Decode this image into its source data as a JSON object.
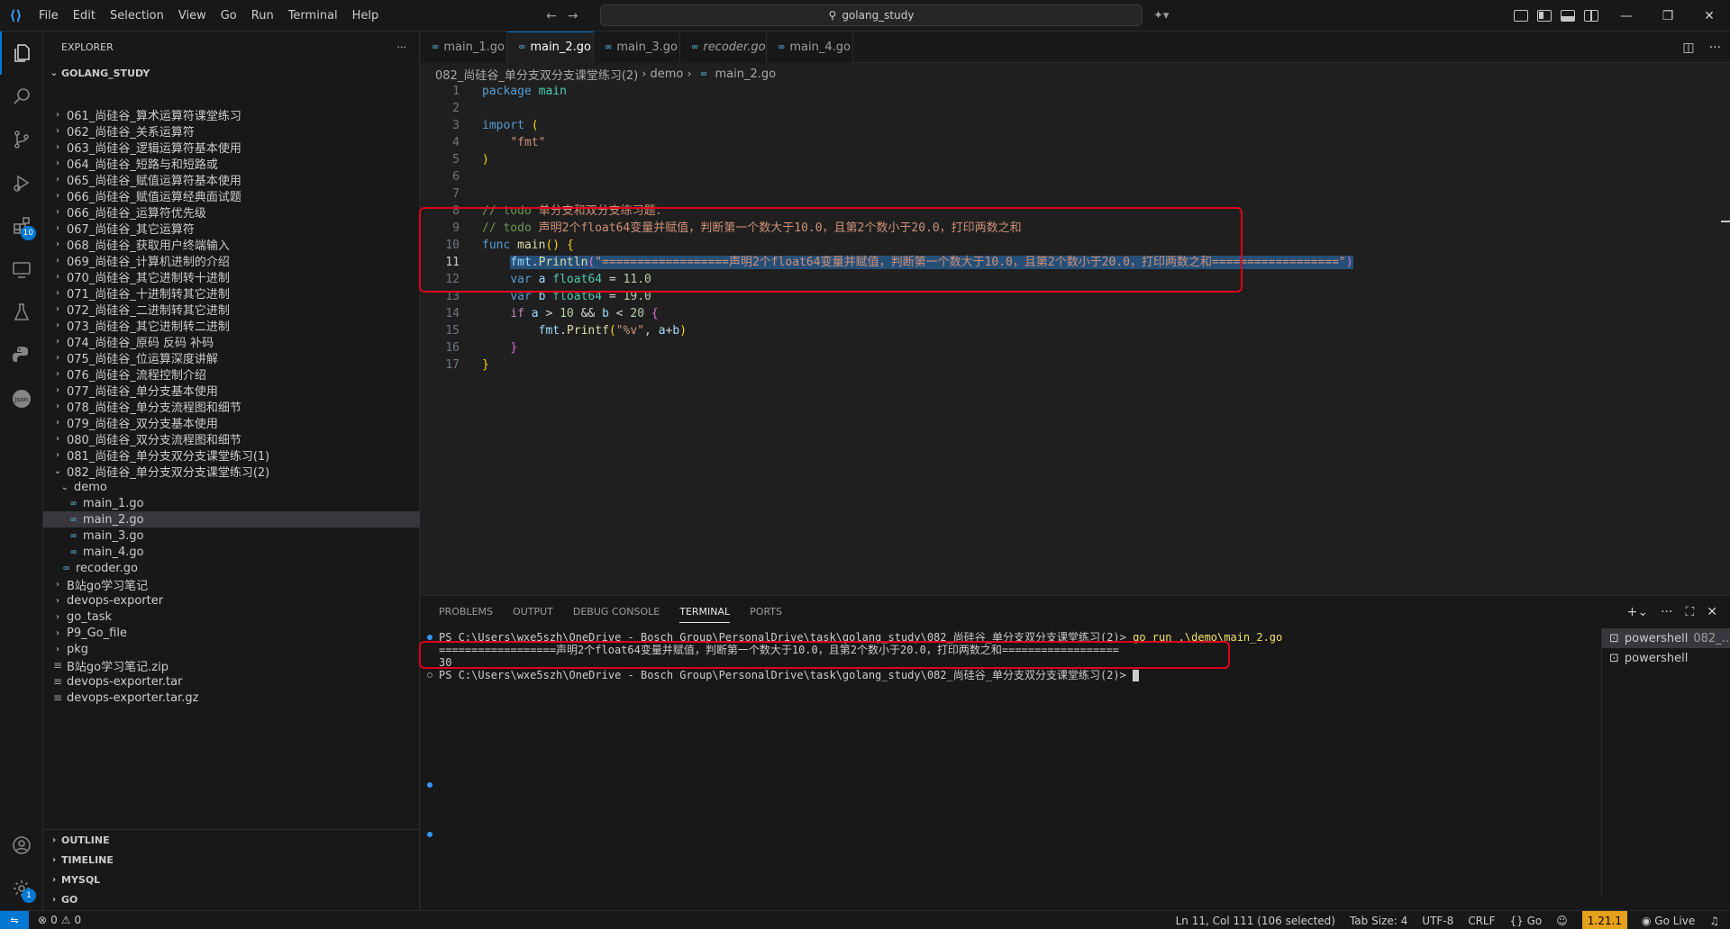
{
  "titlebar": {
    "menu": [
      "File",
      "Edit",
      "Selection",
      "View",
      "Go",
      "Run",
      "Terminal",
      "Help"
    ],
    "search": "golang_study"
  },
  "activity": {
    "extensions_badge": "10",
    "settings_badge": "1"
  },
  "sidebar": {
    "title": "EXPLORER",
    "root": "GOLANG_STUDY",
    "items": [
      {
        "label": "061_尚硅谷_算术运算符课堂练习",
        "kind": "folder",
        "depth": 1
      },
      {
        "label": "062_尚硅谷_关系运算符",
        "kind": "folder",
        "depth": 1
      },
      {
        "label": "063_尚硅谷_逻辑运算符基本使用",
        "kind": "folder",
        "depth": 1
      },
      {
        "label": "064_尚硅谷_短路与和短路或",
        "kind": "folder",
        "depth": 1
      },
      {
        "label": "065_尚硅谷_赋值运算符基本使用",
        "kind": "folder",
        "depth": 1
      },
      {
        "label": "066_尚硅谷_赋值运算经典面试题",
        "kind": "folder",
        "depth": 1
      },
      {
        "label": "066_尚硅谷_运算符优先级",
        "kind": "folder",
        "depth": 1
      },
      {
        "label": "067_尚硅谷_其它运算符",
        "kind": "folder",
        "depth": 1
      },
      {
        "label": "068_尚硅谷_获取用户终端输入",
        "kind": "folder",
        "depth": 1
      },
      {
        "label": "069_尚硅谷_计算机进制的介绍",
        "kind": "folder",
        "depth": 1
      },
      {
        "label": "070_尚硅谷_其它进制转十进制",
        "kind": "folder",
        "depth": 1
      },
      {
        "label": "071_尚硅谷_十进制转其它进制",
        "kind": "folder",
        "depth": 1
      },
      {
        "label": "072_尚硅谷_二进制转其它进制",
        "kind": "folder",
        "depth": 1
      },
      {
        "label": "073_尚硅谷_其它进制转二进制",
        "kind": "folder",
        "depth": 1
      },
      {
        "label": "074_尚硅谷_原码 反码 补码",
        "kind": "folder",
        "depth": 1
      },
      {
        "label": "075_尚硅谷_位运算深度讲解",
        "kind": "folder",
        "depth": 1
      },
      {
        "label": "076_尚硅谷_流程控制介绍",
        "kind": "folder",
        "depth": 1
      },
      {
        "label": "077_尚硅谷_单分支基本使用",
        "kind": "folder",
        "depth": 1
      },
      {
        "label": "078_尚硅谷_单分支流程图和细节",
        "kind": "folder",
        "depth": 1
      },
      {
        "label": "079_尚硅谷_双分支基本使用",
        "kind": "folder",
        "depth": 1
      },
      {
        "label": "080_尚硅谷_双分支流程图和细节",
        "kind": "folder",
        "depth": 1
      },
      {
        "label": "081_尚硅谷_单分支双分支课堂练习(1)",
        "kind": "folder",
        "depth": 1
      },
      {
        "label": "082_尚硅谷_单分支双分支课堂练习(2)",
        "kind": "folder-open",
        "depth": 1
      },
      {
        "label": "demo",
        "kind": "folder-open",
        "depth": 2
      },
      {
        "label": "main_1.go",
        "kind": "go",
        "depth": 3
      },
      {
        "label": "main_2.go",
        "kind": "go",
        "depth": 3,
        "selected": true
      },
      {
        "label": "main_3.go",
        "kind": "go",
        "depth": 3
      },
      {
        "label": "main_4.go",
        "kind": "go",
        "depth": 3
      },
      {
        "label": "recoder.go",
        "kind": "go",
        "depth": 2
      },
      {
        "label": "B站go学习笔记",
        "kind": "folder",
        "depth": 1
      },
      {
        "label": "devops-exporter",
        "kind": "folder",
        "depth": 1
      },
      {
        "label": "go_task",
        "kind": "folder",
        "depth": 1
      },
      {
        "label": "P9_Go_file",
        "kind": "folder",
        "depth": 1
      },
      {
        "label": "pkg",
        "kind": "folder",
        "depth": 1
      },
      {
        "label": "B站go学习笔记.zip",
        "kind": "file",
        "depth": 1
      },
      {
        "label": "devops-exporter.tar",
        "kind": "file",
        "depth": 1
      },
      {
        "label": "devops-exporter.tar.gz",
        "kind": "file",
        "depth": 1
      }
    ],
    "sections": [
      "OUTLINE",
      "TIMELINE",
      "MYSQL",
      "GO"
    ]
  },
  "editor": {
    "tabs": [
      {
        "label": "main_1.go",
        "active": false,
        "italic": false
      },
      {
        "label": "main_2.go",
        "active": true,
        "italic": false
      },
      {
        "label": "main_3.go",
        "active": false,
        "italic": false
      },
      {
        "label": "recoder.go",
        "active": false,
        "italic": true
      },
      {
        "label": "main_4.go",
        "active": false,
        "italic": false
      }
    ],
    "breadcrumb": [
      "082_尚硅谷_单分支双分支课堂练习(2)",
      "demo",
      "main_2.go"
    ],
    "current_line": 11,
    "lines": [
      [
        [
          "kw",
          "package"
        ],
        [
          "pn",
          " "
        ],
        [
          "ty",
          "main"
        ]
      ],
      [],
      [
        [
          "kw",
          "import"
        ],
        [
          "pn",
          " "
        ],
        [
          "br1",
          "("
        ]
      ],
      [
        [
          "pn",
          "    "
        ],
        [
          "str",
          "\"fmt\""
        ]
      ],
      [
        [
          "br1",
          ")"
        ]
      ],
      [],
      [],
      [
        [
          "cm",
          "// todo "
        ],
        [
          "cmh",
          "单分支和双分支练习题："
        ]
      ],
      [
        [
          "cm",
          "// todo "
        ],
        [
          "cmh",
          "声明2个float64变量并赋值，判断第一个数大于10.0，且第2个数小于20.0，打印两数之和"
        ]
      ],
      [
        [
          "kw",
          "func"
        ],
        [
          "pn",
          " "
        ],
        [
          "fn",
          "main"
        ],
        [
          "br1",
          "()"
        ],
        [
          "pn",
          " "
        ],
        [
          "br1",
          "{"
        ]
      ],
      [
        [
          "pn",
          "    "
        ],
        [
          "id sel",
          "fmt"
        ],
        [
          "pn sel",
          "."
        ],
        [
          "fn sel",
          "Println"
        ],
        [
          "br2 sel",
          "("
        ],
        [
          "str sel",
          "\"==================声明2个float64变量并赋值，判断第一个数大于10.0，且第2个数小于20.0，打印两数之和==================\""
        ],
        [
          "br2 sel",
          ")"
        ]
      ],
      [
        [
          "pn",
          "    "
        ],
        [
          "kw",
          "var"
        ],
        [
          "pn",
          " "
        ],
        [
          "id",
          "a"
        ],
        [
          "pn",
          " "
        ],
        [
          "ty",
          "float64"
        ],
        [
          "pn",
          " = "
        ],
        [
          "num",
          "11.0"
        ]
      ],
      [
        [
          "pn",
          "    "
        ],
        [
          "kw",
          "var"
        ],
        [
          "pn",
          " "
        ],
        [
          "id",
          "b"
        ],
        [
          "pn",
          " "
        ],
        [
          "ty",
          "float64"
        ],
        [
          "pn",
          " = "
        ],
        [
          "num",
          "19.0"
        ]
      ],
      [
        [
          "pn",
          "    "
        ],
        [
          "kw2",
          "if"
        ],
        [
          "pn",
          " "
        ],
        [
          "id",
          "a"
        ],
        [
          "pn",
          " > "
        ],
        [
          "num",
          "10"
        ],
        [
          "pn",
          " && "
        ],
        [
          "id",
          "b"
        ],
        [
          "pn",
          " < "
        ],
        [
          "num",
          "20"
        ],
        [
          "pn",
          " "
        ],
        [
          "br2",
          "{"
        ]
      ],
      [
        [
          "pn",
          "        "
        ],
        [
          "id",
          "fmt"
        ],
        [
          "pn",
          "."
        ],
        [
          "fn",
          "Printf"
        ],
        [
          "br1",
          "("
        ],
        [
          "str",
          "\"%v\""
        ],
        [
          "pn",
          ", "
        ],
        [
          "id",
          "a"
        ],
        [
          "pn",
          "+"
        ],
        [
          "id",
          "b"
        ],
        [
          "br1",
          ")"
        ]
      ],
      [
        [
          "pn",
          "    "
        ],
        [
          "br2",
          "}"
        ]
      ],
      [
        [
          "br1",
          "}"
        ]
      ]
    ]
  },
  "panel": {
    "tabs": [
      "PROBLEMS",
      "OUTPUT",
      "DEBUG CONSOLE",
      "TERMINAL",
      "PORTS"
    ],
    "active_tab": "TERMINAL",
    "terminal": {
      "prompt1": "PS C:\\Users\\wxe5szh\\OneDrive - Bosch Group\\PersonalDrive\\task\\golang_study\\082_尚硅谷_单分支双分支课堂练习(2)> ",
      "cmd1": "go run .\\demo\\main_2.go",
      "out1": "==================声明2个float64变量并赋值，判断第一个数大于10.0，且第2个数小于20.0，打印两数之和==================",
      "out2": "30",
      "prompt2": "PS C:\\Users\\wxe5szh\\OneDrive - Bosch Group\\PersonalDrive\\task\\golang_study\\082_尚硅谷_单分支双分支课堂练习(2)> "
    },
    "terminals": [
      {
        "label": "powershell",
        "sub": "082_..."
      },
      {
        "label": "powershell",
        "sub": ""
      }
    ]
  },
  "statusbar": {
    "errors": "0",
    "warnings": "0",
    "position": "Ln 11, Col 111 (106 selected)",
    "tab_size": "Tab Size: 4",
    "encoding": "UTF-8",
    "eol": "CRLF",
    "language": "Go",
    "go_version": "1.21.1",
    "go_live": "Go Live"
  },
  "colors": {
    "accent": "#0078d4",
    "highlight_box": "#e0001b",
    "go_version_badge": "#e6a11c"
  }
}
